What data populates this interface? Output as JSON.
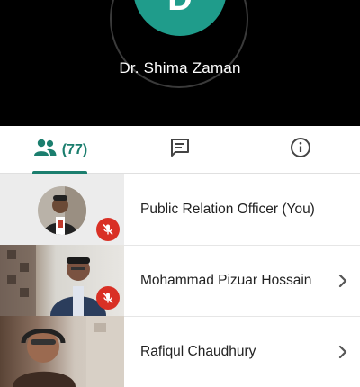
{
  "speaker": {
    "initial": "D",
    "name": "Dr. Shima Zaman",
    "avatar_color": "#1f9c8b"
  },
  "tabs": {
    "people": {
      "icon": "people-icon",
      "count": "(77)",
      "active": true
    },
    "chat": {
      "icon": "chat-icon"
    },
    "info": {
      "icon": "info-icon"
    },
    "accent": "#1b7e6e"
  },
  "participants": [
    {
      "name": "Public Relation Officer (You)",
      "muted": true,
      "has_chevron": false
    },
    {
      "name": "Mohammad Pizuar Hossain",
      "muted": true,
      "has_chevron": true
    },
    {
      "name": "Rafiqul Chaudhury",
      "muted": false,
      "has_chevron": true
    }
  ],
  "colors": {
    "mute_badge": "#d93025",
    "header_bg": "#000000"
  }
}
